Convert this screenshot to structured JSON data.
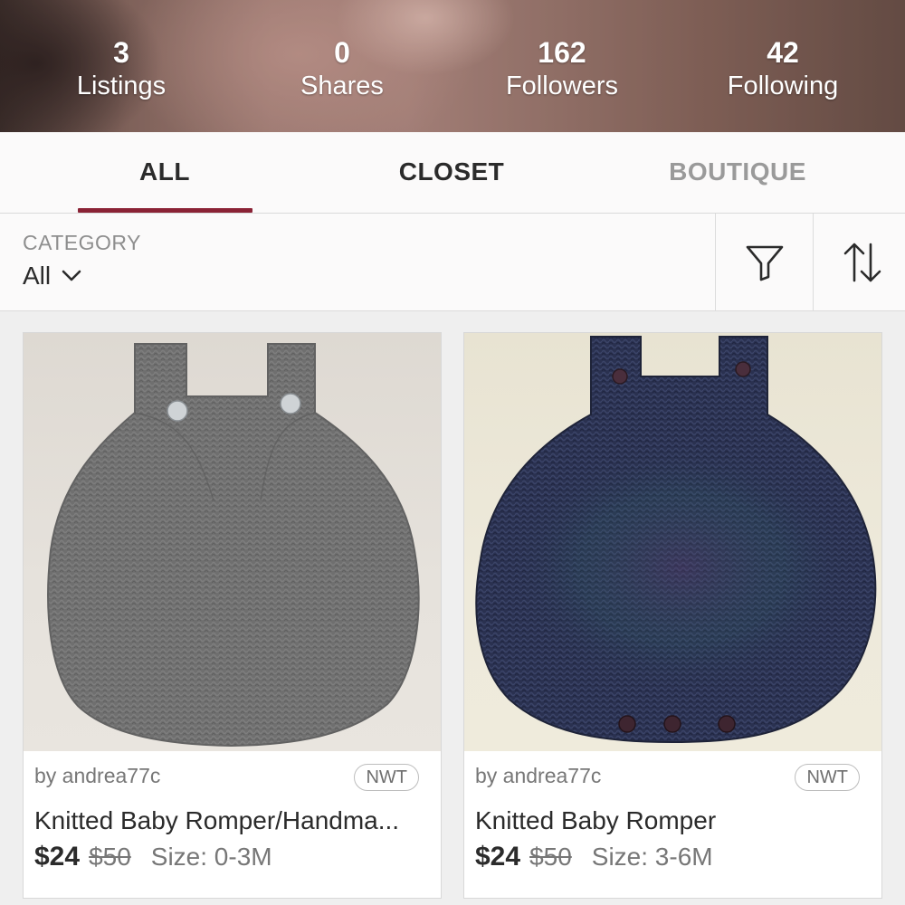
{
  "stats": [
    {
      "number": "3",
      "label": "Listings"
    },
    {
      "number": "0",
      "label": "Shares"
    },
    {
      "number": "162",
      "label": "Followers"
    },
    {
      "number": "42",
      "label": "Following"
    }
  ],
  "tabs": [
    {
      "label": "ALL",
      "active": true
    },
    {
      "label": "CLOSET",
      "active": false
    },
    {
      "label": "BOUTIQUE",
      "active": false
    }
  ],
  "filter_bar": {
    "category_label": "CATEGORY",
    "category_value": "All",
    "icons": [
      "chevron-down-icon",
      "filter-funnel-icon",
      "sort-arrows-icon"
    ]
  },
  "listings": [
    {
      "seller": "by andrea77c",
      "badge": "NWT",
      "title": "Knitted Baby Romper/Handma...",
      "price": "$24",
      "original_price": "$50",
      "size": "Size: 0-3M"
    },
    {
      "seller": "by andrea77c",
      "badge": "NWT",
      "title": "Knitted Baby Romper",
      "price": "$24",
      "original_price": "$50",
      "size": "Size: 3-6M"
    }
  ],
  "colors": {
    "accent": "#8a2235",
    "text_primary": "#2b2b2b",
    "text_secondary": "#777777",
    "tab_inactive": "#9a9a9a"
  }
}
